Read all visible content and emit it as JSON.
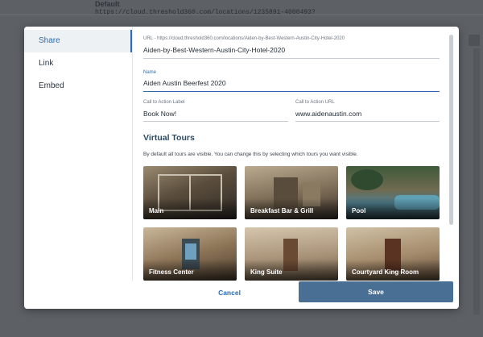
{
  "background": {
    "label": "Default",
    "url": "https://cloud.threshold360.com/locations/1235891-4000493?"
  },
  "sidebar": {
    "items": [
      {
        "label": "Share",
        "active": true
      },
      {
        "label": "Link",
        "active": false
      },
      {
        "label": "Embed",
        "active": false
      }
    ]
  },
  "form": {
    "url_label": "URL - https://cloud.threshold360.com/locations/Aiden-by-Best-Western-Austin-City-Hotel-2020",
    "url_value": "Aiden-by-Best-Western-Austin-City-Hotel-2020",
    "name_label": "Name",
    "name_value": "Aiden Austin Beerfest 2020",
    "cta_label_label": "Call to Action Label",
    "cta_label_value": "Book Now!",
    "cta_url_label": "Call to Action URL",
    "cta_url_value": "www.aidenaustin.com"
  },
  "tours_section": {
    "title": "Virtual Tours",
    "hint": "By default all tours are visible. You can change this by selecting which tours you want visible.",
    "tours": [
      {
        "label": "Main"
      },
      {
        "label": "Breakfast Bar & Grill"
      },
      {
        "label": "Pool"
      },
      {
        "label": "Fitness Center"
      },
      {
        "label": "King Suite"
      },
      {
        "label": "Courtyard King Room"
      }
    ]
  },
  "footer": {
    "cancel_label": "Cancel",
    "save_label": "Save"
  },
  "colors": {
    "accent": "#2b6cb0",
    "save_button": "#4a6f94",
    "backdrop": "#5d6166"
  }
}
